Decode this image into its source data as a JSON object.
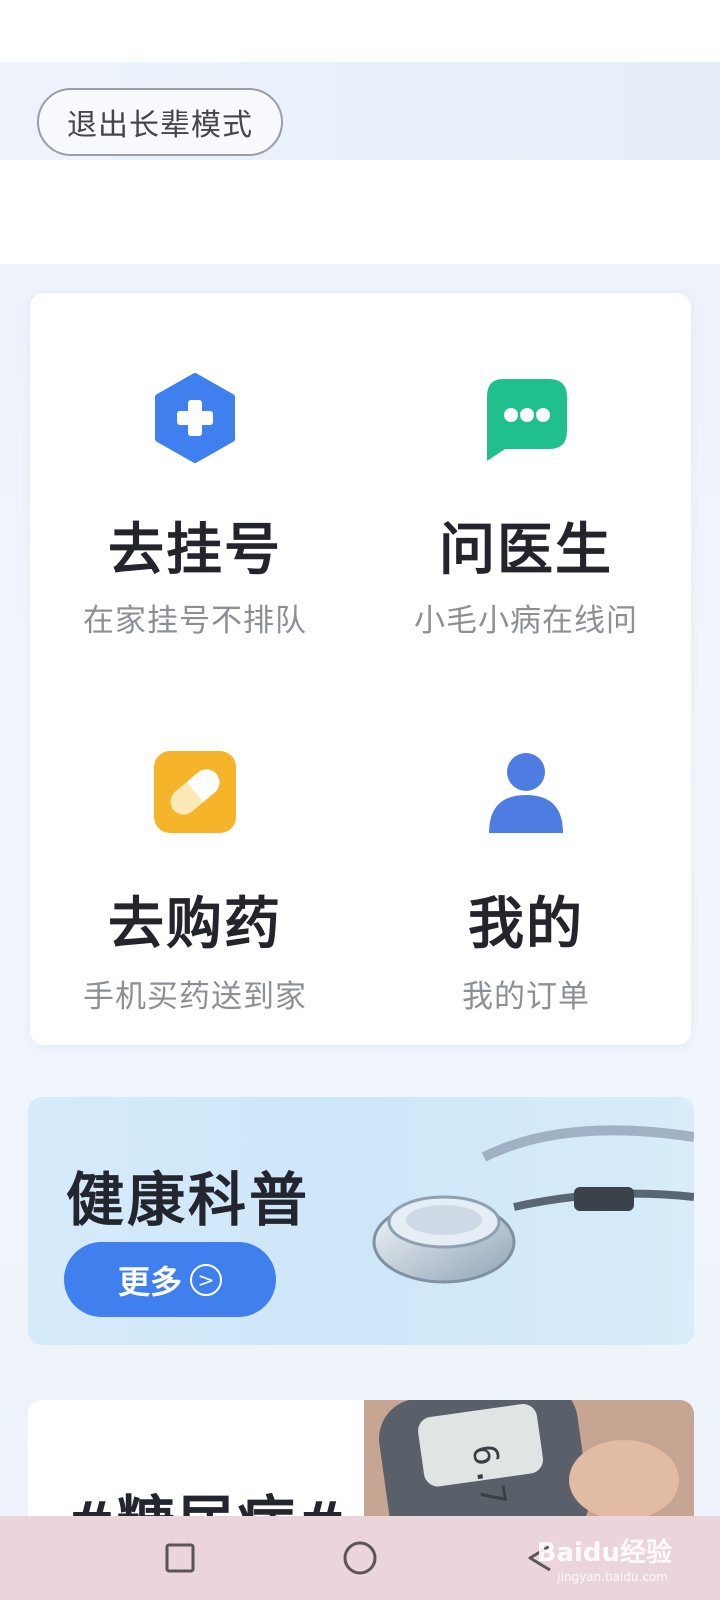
{
  "elder_mode": {
    "exit_label": "退出长辈模式"
  },
  "services": [
    {
      "title": "去挂号",
      "subtitle": "在家挂号不排队",
      "icon": "hospital-plus-icon",
      "color": "#3f80ee"
    },
    {
      "title": "问医生",
      "subtitle": "小毛小病在线问",
      "icon": "chat-bubble-icon",
      "color": "#20c08e"
    },
    {
      "title": "去购药",
      "subtitle": "手机买药送到家",
      "icon": "pill-icon",
      "color": "#f5b429"
    },
    {
      "title": "我的",
      "subtitle": "我的订单",
      "icon": "user-icon",
      "color": "#4d7de0"
    }
  ],
  "health_banner": {
    "title": "健康科普",
    "more_label": "更多"
  },
  "topic_card": {
    "title": "#糖尿病#"
  },
  "watermark": {
    "text": "Baidu经验",
    "sub": "jingyan.baidu.com"
  },
  "colors": {
    "accent": "#3f80ee",
    "nav_bar": "#ecd5da"
  }
}
